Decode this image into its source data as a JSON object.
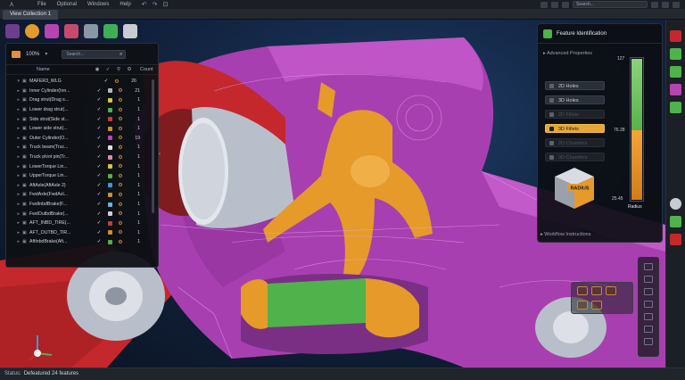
{
  "menubar": {
    "items": [
      "File",
      "Optional",
      "Windows",
      "Help"
    ],
    "search_placeholder": "Search..."
  },
  "tabbar": {
    "tab_label": "View Collection 1"
  },
  "tree_panel": {
    "zoom": "100%",
    "search_placeholder": "Search...",
    "columns": {
      "name": "Name",
      "count": "Count"
    },
    "root": {
      "label": "MAFER3_WLG",
      "count": "26"
    },
    "rows": [
      {
        "label": "Inner Cylinder(Inn...",
        "color": "#b0b7c3",
        "count": "21"
      },
      {
        "label": "Drag strut(Drag s...",
        "color": "#d9c43a",
        "count": "1"
      },
      {
        "label": "Lower drag strut(...",
        "color": "#4fb24a",
        "count": "1"
      },
      {
        "label": "Side strut(Side st...",
        "color": "#c83a3a",
        "count": "1"
      },
      {
        "label": "Lower side strut(...",
        "color": "#d08e2a",
        "count": "1"
      },
      {
        "label": "Outer Cylinder(O...",
        "color": "#c040c0",
        "count": "19"
      },
      {
        "label": "Truck beam(Truc...",
        "color": "#e0e0e0",
        "count": "1"
      },
      {
        "label": "Truck pivot pin(Tr...",
        "color": "#e08aa8",
        "count": "1"
      },
      {
        "label": "LowerTorque Lin...",
        "color": "#d9c43a",
        "count": "1"
      },
      {
        "label": "UpperTorque Lin...",
        "color": "#4fb24a",
        "count": "1"
      },
      {
        "label": "AftAxle(AftAxle 2)",
        "color": "#3a9ad9",
        "count": "1"
      },
      {
        "label": "FwdAxle(FwdAxl...",
        "color": "#d08e2a",
        "count": "1"
      },
      {
        "label": "FwdInbdBrake(F...",
        "color": "#6ab0e0",
        "count": "1"
      },
      {
        "label": "FwdOutbdBrake(...",
        "color": "#d0d0d0",
        "count": "1"
      },
      {
        "label": "AFT_INBD_TIRE(...",
        "color": "#c83a3a",
        "count": "1"
      },
      {
        "label": "AFT_OUTBD_TIR...",
        "color": "#d08e2a",
        "count": "1"
      },
      {
        "label": "AftInbdBrake(Aft...",
        "color": "#4fb24a",
        "count": "1"
      }
    ]
  },
  "feature_panel": {
    "title": "Feature Identification",
    "advanced": "Advanced Properties",
    "buttons": [
      {
        "label": "2D Holes",
        "state": "normal"
      },
      {
        "label": "3D Holes",
        "state": "normal"
      },
      {
        "label": "2D Fillets",
        "state": "disabled"
      },
      {
        "label": "3D Fillets",
        "state": "active"
      },
      {
        "label": "2D Chamfers",
        "state": "disabled"
      },
      {
        "label": "3D Chamfers",
        "state": "disabled"
      }
    ],
    "scale_top": "127",
    "scale_mid": "76.28",
    "scale_bottom": "25.45",
    "scale_label": "Radius",
    "cube_label": "RADIUS",
    "workflow": "Workflow Instructions"
  },
  "statusbar": {
    "label": "Status:",
    "value": "Defeatured 24 features"
  },
  "colors": {
    "magenta": "#a83fb0",
    "orange": "#e69a2a",
    "red": "#c4282c",
    "green": "#4fb24a",
    "active_button": "#e6a734"
  }
}
